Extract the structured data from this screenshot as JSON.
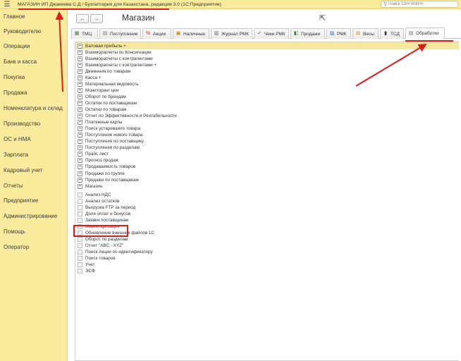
{
  "titlebar": {
    "title": "МАГАЗИН ИП Джакеева С.Д / Бухгалтерия для Казахстана, редакция 3.0  (1С:Предприятие)",
    "search_placeholder": "Поиск Ctrl+Shift+F"
  },
  "sidebar": {
    "items": [
      {
        "label": "Главное"
      },
      {
        "label": "Руководителю"
      },
      {
        "label": "Операции"
      },
      {
        "label": "Банк и касса"
      },
      {
        "label": "Покупка"
      },
      {
        "label": "Продажа"
      },
      {
        "label": "Номенклатура и склад"
      },
      {
        "label": "Производство"
      },
      {
        "label": "ОС и НМА"
      },
      {
        "label": "Зарплата"
      },
      {
        "label": "Кадровый учет"
      },
      {
        "label": "Отчеты"
      },
      {
        "label": "Предприятие"
      },
      {
        "label": "Администрирование"
      },
      {
        "label": "Помощь"
      },
      {
        "label": "Оператор"
      }
    ]
  },
  "header": {
    "back": "←",
    "forward": "→",
    "page_title": "Магазин"
  },
  "tabs": [
    {
      "label": "ТМЦ",
      "icon": "table-icon"
    },
    {
      "label": "Поступление",
      "icon": "document-icon"
    },
    {
      "label": "Акции",
      "icon": "percent-icon"
    },
    {
      "label": "Наличные",
      "icon": "cash-icon"
    },
    {
      "label": "Журнал РМК",
      "icon": "journal-icon"
    },
    {
      "label": "Чеки РМК",
      "icon": "check-icon"
    },
    {
      "label": "Продажи",
      "icon": "sales-icon"
    },
    {
      "label": "РМК",
      "icon": "cashier-icon"
    },
    {
      "label": "Весы",
      "icon": "scales-icon"
    },
    {
      "label": "ТСД",
      "icon": "terminal-icon"
    },
    {
      "label": "Обработки",
      "icon": "processing-icon",
      "active": true
    }
  ],
  "list": {
    "report_items": [
      "Валовая прибыль +",
      "Взаиморасчеты по Консигнации",
      "Взаиморасчеты с контрагентами",
      "Взаиморасчеты с контрагентами +",
      "Движения по товарам",
      "Касса +",
      "Материальная ведомость",
      "Мониторинг цен",
      "Оборот по брендам",
      "Остатки по поставщикам",
      "Остатки по товарам",
      "Отчет по Эффективности и Рентабельности",
      "Платежные карты",
      "Поиск устаревшего товара",
      "Поступление нового товара",
      "Поступления по поставщику",
      "Поступления по разделам",
      "Прайс лист",
      "Прогноз продаж",
      "Продаваемость товаров",
      "Продажи по группе",
      "Продажи по поставщикам",
      "Магазин"
    ],
    "processing_items": [
      "Анализ НДС",
      "Анализ остатков",
      "Выгрузка FTP за период",
      "Доля оплат и бонусов",
      "Заявки поставщикам",
      "Инвентаризация",
      "Обновление внешних файлов 1С",
      "Оборот по разделам",
      "Отчет \"ABC - XYZ\"",
      "Поиск Акции по идентификатору",
      "Поиск товаров",
      "Учет",
      "ЭСФ"
    ]
  },
  "colors": {
    "sidebar_bg": "#fbeb9c",
    "selected_row": "#f6e8a1",
    "annotation_red": "#e01b1b"
  }
}
